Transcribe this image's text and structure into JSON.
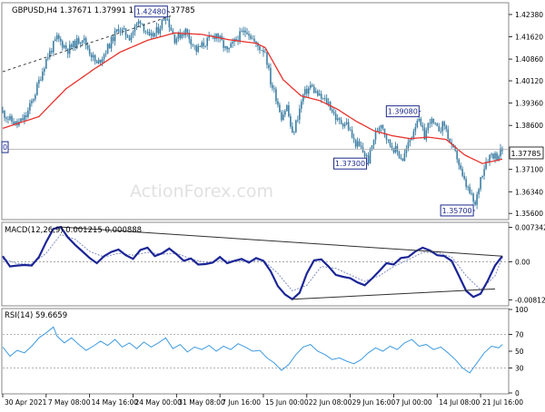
{
  "colors": {
    "background": "#ffffff",
    "candle": "#3e7fa4",
    "moving_average": "#e8322c",
    "annotation_box": "#1b2a8c",
    "macd_line": "#1b2596",
    "signal_line": "#7f8cc2",
    "rsi_line": "#3f9be0",
    "trend_line": "#303030",
    "grid": "#9a9a9a",
    "watermark": "#e1e1e1"
  },
  "watermark": "ActionForex.com",
  "chart_data": [
    {
      "type": "candlestick",
      "title": "GBPUSD,H4  1.37671 1.37991 1.37625 1.37785",
      "y_range": [
        1.3542,
        1.4275
      ],
      "y_ticks": [
        "1.42380",
        "1.41620",
        "1.40860",
        "1.40120",
        "1.39360",
        "1.38600",
        "1.37100",
        "1.36340",
        "1.35600"
      ],
      "current_price": "1.37785",
      "annotations": [
        "1.42480",
        "1.39080",
        "1.37300",
        "1.35700",
        "0"
      ],
      "legend": "top-left",
      "grid": false,
      "close_path": [
        [
          0,
          1.3905
        ],
        [
          4,
          1.3878
        ],
        [
          8,
          1.3862
        ],
        [
          13,
          1.3892
        ],
        [
          18,
          1.3972
        ],
        [
          24,
          1.4085
        ],
        [
          30,
          1.4157
        ],
        [
          36,
          1.4118
        ],
        [
          44,
          1.416
        ],
        [
          52,
          1.4066
        ],
        [
          58,
          1.4125
        ],
        [
          64,
          1.4192
        ],
        [
          70,
          1.4162
        ],
        [
          76,
          1.4221
        ],
        [
          81,
          1.4154
        ],
        [
          86,
          1.4187
        ],
        [
          90,
          1.4238
        ],
        [
          95,
          1.4155
        ],
        [
          101,
          1.4183
        ],
        [
          107,
          1.4116
        ],
        [
          112,
          1.4142
        ],
        [
          118,
          1.4172
        ],
        [
          124,
          1.411
        ],
        [
          130,
          1.4161
        ],
        [
          135,
          1.4186
        ],
        [
          140,
          1.4133
        ],
        [
          145,
          1.4114
        ],
        [
          148,
          1.4008
        ],
        [
          151,
          1.3957
        ],
        [
          154,
          1.3891
        ],
        [
          157,
          1.3925
        ],
        [
          160,
          1.3824
        ],
        [
          163,
          1.3891
        ],
        [
          166,
          1.3962
        ],
        [
          170,
          1.3995
        ],
        [
          175,
          1.3956
        ],
        [
          180,
          1.3936
        ],
        [
          185,
          1.3874
        ],
        [
          190,
          1.3867
        ],
        [
          194,
          1.3806
        ],
        [
          198,
          1.378
        ],
        [
          202,
          1.3741
        ],
        [
          205,
          1.3816
        ],
        [
          209,
          1.3872
        ],
        [
          213,
          1.3803
        ],
        [
          217,
          1.3776
        ],
        [
          221,
          1.3745
        ],
        [
          225,
          1.381
        ],
        [
          229,
          1.3884
        ],
        [
          233,
          1.3823
        ],
        [
          236,
          1.388
        ],
        [
          240,
          1.3845
        ],
        [
          244,
          1.3863
        ],
        [
          248,
          1.3783
        ],
        [
          251,
          1.3752
        ],
        [
          254,
          1.368
        ],
        [
          258,
          1.3629
        ],
        [
          261,
          1.3585
        ],
        [
          264,
          1.3683
        ],
        [
          267,
          1.374
        ],
        [
          270,
          1.3764
        ],
        [
          273,
          1.3754
        ],
        [
          276,
          1.3778
        ]
      ],
      "moving_average": [
        [
          0,
          1.385
        ],
        [
          20,
          1.389
        ],
        [
          35,
          1.3985
        ],
        [
          50,
          1.405
        ],
        [
          65,
          1.411
        ],
        [
          80,
          1.415
        ],
        [
          95,
          1.4175
        ],
        [
          110,
          1.417
        ],
        [
          125,
          1.4152
        ],
        [
          140,
          1.414
        ],
        [
          145,
          1.4125
        ],
        [
          155,
          1.4015
        ],
        [
          165,
          1.396
        ],
        [
          175,
          1.3945
        ],
        [
          185,
          1.3915
        ],
        [
          195,
          1.3875
        ],
        [
          205,
          1.3842
        ],
        [
          215,
          1.3825
        ],
        [
          225,
          1.3815
        ],
        [
          235,
          1.382
        ],
        [
          245,
          1.3812
        ],
        [
          255,
          1.376
        ],
        [
          265,
          1.373
        ],
        [
          276,
          1.3745
        ]
      ]
    },
    {
      "type": "line",
      "title": "MACD(12,26,9) 0.001215 0.000888",
      "y_range": [
        -0.0092,
        0.0082
      ],
      "y_ticks": [
        "0.007342",
        "0.00",
        "-0.008126"
      ],
      "zero_line": "dotted",
      "macd": [
        [
          0,
          0.0012
        ],
        [
          4,
          -0.001
        ],
        [
          8,
          -0.0008
        ],
        [
          12,
          -0.0007
        ],
        [
          16,
          -0.0008
        ],
        [
          20,
          0.001
        ],
        [
          24,
          0.0042
        ],
        [
          28,
          0.007
        ],
        [
          32,
          0.0074
        ],
        [
          36,
          0.0052
        ],
        [
          40,
          0.0036
        ],
        [
          44,
          0.0022
        ],
        [
          48,
          0.0008
        ],
        [
          52,
          -0.0003
        ],
        [
          56,
          0.0012
        ],
        [
          60,
          0.0021
        ],
        [
          64,
          0.0026
        ],
        [
          68,
          0.0014
        ],
        [
          72,
          0.0006
        ],
        [
          76,
          0.0025
        ],
        [
          80,
          0.003
        ],
        [
          84,
          0.0012
        ],
        [
          88,
          0.0018
        ],
        [
          92,
          0.0028
        ],
        [
          96,
          0.0016
        ],
        [
          100,
          0.0002
        ],
        [
          104,
          0.0007
        ],
        [
          108,
          -0.0006
        ],
        [
          112,
          -0.0005
        ],
        [
          116,
          -0.0002
        ],
        [
          120,
          0.001
        ],
        [
          124,
          -0.0003
        ],
        [
          128,
          0.0002
        ],
        [
          132,
          0.0006
        ],
        [
          136,
          -0.0002
        ],
        [
          140,
          0.0008
        ],
        [
          144,
          0.0002
        ],
        [
          148,
          -0.002
        ],
        [
          152,
          -0.0052
        ],
        [
          156,
          -0.007
        ],
        [
          160,
          -0.008
        ],
        [
          164,
          -0.0066
        ],
        [
          168,
          -0.0025
        ],
        [
          172,
          0.0003
        ],
        [
          176,
          0.0005
        ],
        [
          180,
          -0.001
        ],
        [
          184,
          -0.0028
        ],
        [
          188,
          -0.0032
        ],
        [
          192,
          -0.0035
        ],
        [
          196,
          -0.0044
        ],
        [
          200,
          -0.005
        ],
        [
          204,
          -0.0036
        ],
        [
          208,
          -0.002
        ],
        [
          212,
          -0.0003
        ],
        [
          216,
          -0.0006
        ],
        [
          220,
          0.0008
        ],
        [
          224,
          0.001
        ],
        [
          228,
          0.0022
        ],
        [
          232,
          0.003
        ],
        [
          236,
          0.0024
        ],
        [
          240,
          0.0014
        ],
        [
          244,
          0.0012
        ],
        [
          248,
          0.0002
        ],
        [
          252,
          -0.003
        ],
        [
          256,
          -0.0062
        ],
        [
          260,
          -0.0075
        ],
        [
          264,
          -0.0068
        ],
        [
          268,
          -0.004
        ],
        [
          272,
          -0.0008
        ],
        [
          276,
          0.0012
        ]
      ],
      "signal": [
        [
          0,
          0.0006
        ],
        [
          8,
          -0.0004
        ],
        [
          16,
          -0.0005
        ],
        [
          24,
          0.0018
        ],
        [
          32,
          0.0058
        ],
        [
          40,
          0.0048
        ],
        [
          48,
          0.0022
        ],
        [
          56,
          0.001
        ],
        [
          64,
          0.0018
        ],
        [
          72,
          0.0014
        ],
        [
          80,
          0.002
        ],
        [
          88,
          0.0016
        ],
        [
          96,
          0.0018
        ],
        [
          104,
          0.0006
        ],
        [
          112,
          -0.0002
        ],
        [
          120,
          0.0003
        ],
        [
          128,
          0.0002
        ],
        [
          136,
          0.0002
        ],
        [
          144,
          0.0003
        ],
        [
          152,
          -0.0025
        ],
        [
          160,
          -0.0062
        ],
        [
          168,
          -0.005
        ],
        [
          176,
          -0.001
        ],
        [
          184,
          -0.0014
        ],
        [
          192,
          -0.0028
        ],
        [
          200,
          -0.0042
        ],
        [
          208,
          -0.003
        ],
        [
          216,
          -0.001
        ],
        [
          224,
          0.0004
        ],
        [
          232,
          0.002
        ],
        [
          240,
          0.002
        ],
        [
          248,
          0.001
        ],
        [
          256,
          -0.003
        ],
        [
          264,
          -0.006
        ],
        [
          272,
          -0.003
        ],
        [
          276,
          0.0009
        ]
      ],
      "trend_lines": [
        [
          [
            32,
            0.0074
          ],
          [
            276,
            0.0012
          ]
        ],
        [
          [
            160,
            -0.008
          ],
          [
            272,
            -0.0058
          ]
        ]
      ]
    },
    {
      "type": "line",
      "title": "RSI(14) 59.6659",
      "y_range": [
        0,
        100
      ],
      "y_ticks": [
        "100",
        "70",
        "50",
        "30",
        "0"
      ],
      "levels": [
        70,
        30
      ],
      "values": [
        [
          0,
          55
        ],
        [
          4,
          44
        ],
        [
          8,
          51
        ],
        [
          12,
          48
        ],
        [
          16,
          56
        ],
        [
          20,
          66
        ],
        [
          24,
          72
        ],
        [
          28,
          79
        ],
        [
          30,
          68
        ],
        [
          34,
          60
        ],
        [
          38,
          66
        ],
        [
          42,
          58
        ],
        [
          46,
          51
        ],
        [
          50,
          56
        ],
        [
          54,
          62
        ],
        [
          58,
          57
        ],
        [
          62,
          64
        ],
        [
          66,
          55
        ],
        [
          70,
          60
        ],
        [
          74,
          53
        ],
        [
          78,
          61
        ],
        [
          82,
          55
        ],
        [
          86,
          60
        ],
        [
          90,
          66
        ],
        [
          94,
          53
        ],
        [
          98,
          58
        ],
        [
          102,
          49
        ],
        [
          106,
          55
        ],
        [
          110,
          52
        ],
        [
          114,
          57
        ],
        [
          118,
          50
        ],
        [
          122,
          56
        ],
        [
          126,
          52
        ],
        [
          130,
          59
        ],
        [
          134,
          55
        ],
        [
          138,
          50
        ],
        [
          142,
          51
        ],
        [
          146,
          42
        ],
        [
          150,
          36
        ],
        [
          154,
          27
        ],
        [
          158,
          34
        ],
        [
          162,
          46
        ],
        [
          166,
          55
        ],
        [
          170,
          58
        ],
        [
          174,
          50
        ],
        [
          178,
          46
        ],
        [
          182,
          40
        ],
        [
          186,
          42
        ],
        [
          190,
          38
        ],
        [
          194,
          35
        ],
        [
          198,
          40
        ],
        [
          202,
          48
        ],
        [
          206,
          54
        ],
        [
          210,
          50
        ],
        [
          214,
          56
        ],
        [
          218,
          52
        ],
        [
          222,
          60
        ],
        [
          226,
          64
        ],
        [
          230,
          56
        ],
        [
          234,
          58
        ],
        [
          238,
          52
        ],
        [
          242,
          55
        ],
        [
          246,
          48
        ],
        [
          250,
          40
        ],
        [
          254,
          30
        ],
        [
          258,
          24
        ],
        [
          262,
          36
        ],
        [
          266,
          48
        ],
        [
          270,
          56
        ],
        [
          274,
          54
        ],
        [
          276,
          58
        ]
      ]
    }
  ],
  "x_axis": {
    "labels": [
      "30 Apr 2021",
      "7 May 08:00",
      "14 May 16:00",
      "24 May 00:00",
      "31 May 08:00",
      "7 Jun 16:00",
      "15 Jun 00:00",
      "22 Jun 08:00",
      "29 Jun 16:00",
      "7 Jul 00:00",
      "14 Jul 08:00",
      "21 Jul 16:00"
    ],
    "label_bars": [
      0,
      24,
      48,
      72,
      96,
      120,
      144,
      168,
      192,
      216,
      240,
      264
    ],
    "bar_count": 278
  }
}
